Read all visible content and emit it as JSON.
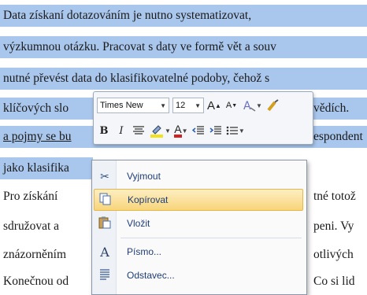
{
  "document": {
    "lines": [
      "Data získaní dotazováním je nutno systematizovat,",
      "výzkumnou otázku. Pracovat s daty ve formě vět a souv",
      "nutné převést data do klasifikovatelné podoby, čehož s",
      "klíčových slo",
      "a pojmy se bu",
      "jako klasifika",
      "Pro získání",
      "sdružovat a",
      "znázorněním",
      "Konečnou od"
    ],
    "right_fragments": {
      "line4": "vědích.",
      "line5": "espondent",
      "line7": "tné totož",
      "line8": "peni. Vy",
      "line9": "otlivých",
      "line10": "Co si lid"
    }
  },
  "mini_toolbar": {
    "font_name": "Times New",
    "font_size": "12",
    "grow_font_label": "A",
    "shrink_font_label": "A",
    "bold_label": "B",
    "italic_label": "I",
    "font_color_label": "A"
  },
  "context_menu": {
    "items": [
      {
        "label": "Vyjmout",
        "icon": "scissors-icon"
      },
      {
        "label": "Kopírovat",
        "icon": "copy-icon"
      },
      {
        "label": "Vložit",
        "icon": "paste-icon"
      },
      {
        "label": "Písmo...",
        "icon": "font-icon"
      },
      {
        "label": "Odstavec...",
        "icon": "paragraph-icon"
      }
    ]
  },
  "colors": {
    "selection": "#a9c6ec",
    "menu_highlight": "#f7d57a",
    "font_color_red": "#d42020"
  }
}
